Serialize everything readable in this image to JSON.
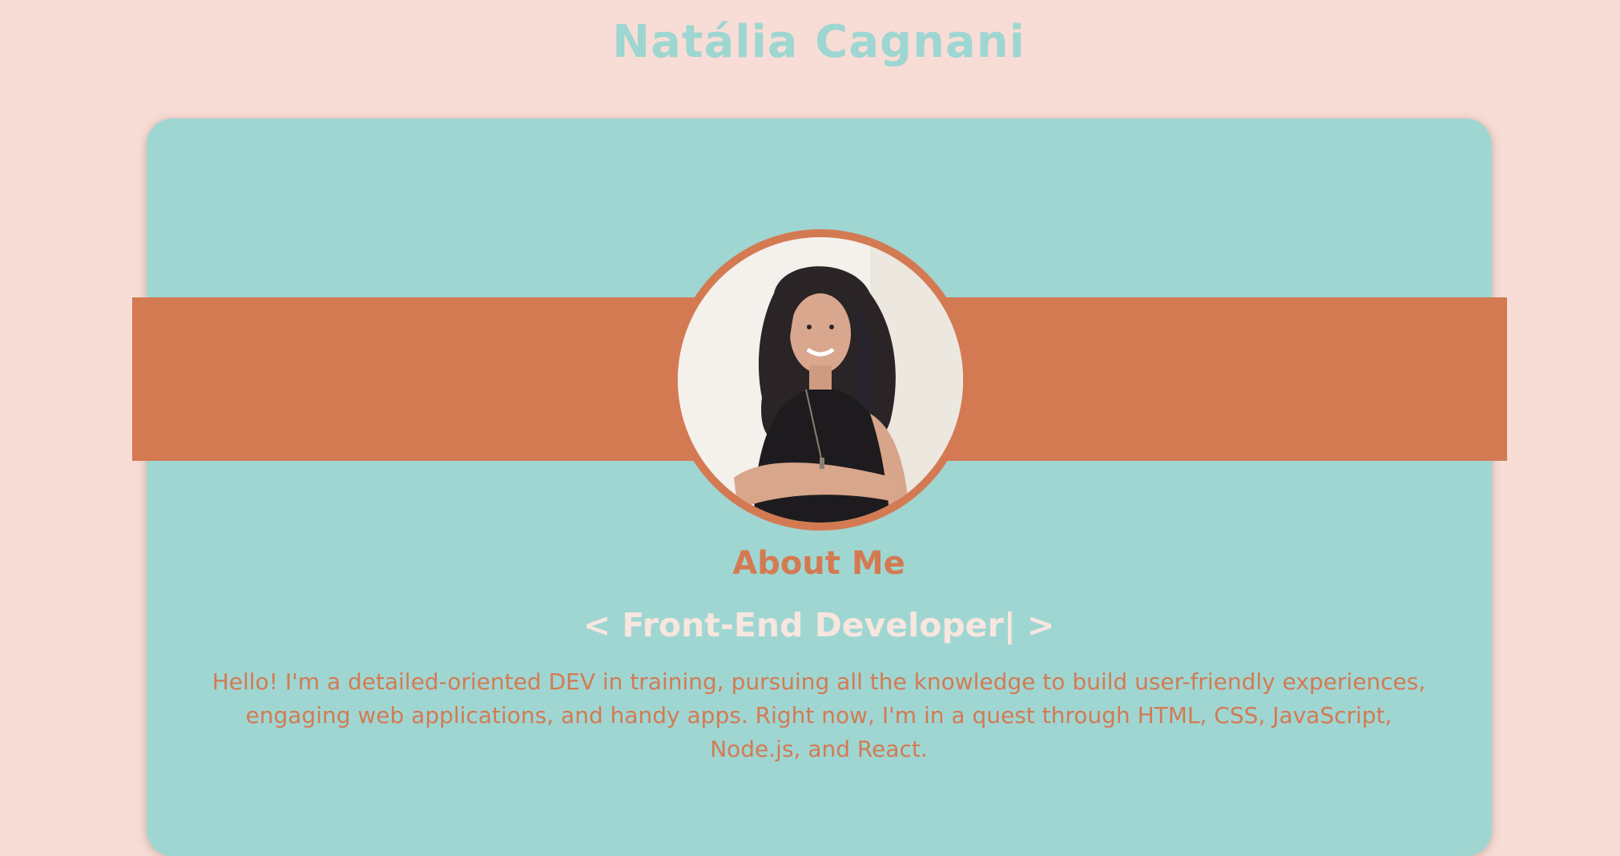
{
  "header": {
    "title": "Natália Cagnani"
  },
  "profile": {
    "photo_alt": "Profile photo",
    "about_heading": "About Me",
    "role": {
      "open_bracket": "<",
      "text": "Front-End Developer|",
      "close_bracket": ">"
    },
    "bio": "Hello! I'm a detailed-oriented DEV in training, pursuing all the knowledge to build user-friendly experiences, engaging web applications, and handy apps. Right now, I'm in a quest through HTML, CSS, JavaScript, Node.js, and React."
  },
  "colors": {
    "background": "#f8ddd6",
    "card": "#9fd6d2",
    "accent": "#d47a53",
    "title": "#9ed6d1",
    "role_text": "#f8e6df"
  }
}
